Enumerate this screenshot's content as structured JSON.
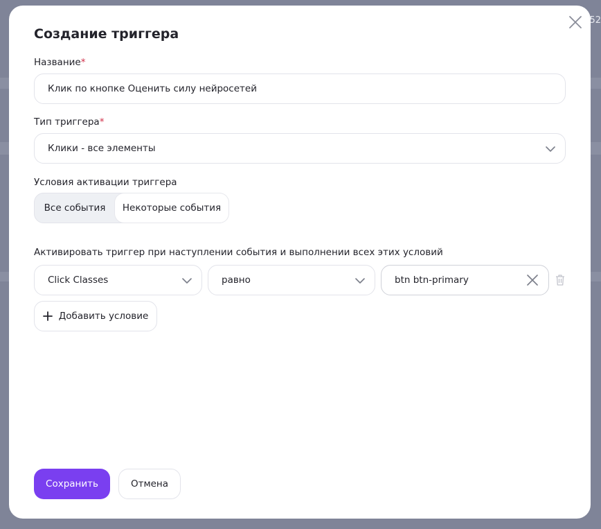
{
  "background": {
    "corner_text": "52"
  },
  "dialog": {
    "title": "Создание триггера",
    "name_field": {
      "label": "Название",
      "required_mark": "*",
      "value": "Клик по кнопке Оценить силу нейросетей"
    },
    "type_field": {
      "label": "Тип триггера",
      "required_mark": "*",
      "value": "Клики - все элементы"
    },
    "activation": {
      "label": "Условия активации триггера",
      "options": [
        "Все события",
        "Некоторые события"
      ],
      "selected": "Все события"
    },
    "conditions": {
      "label": "Активировать триггер при наступлении события и выполнении всех этих условий",
      "rows": [
        {
          "variable": "Click Classes",
          "operator": "равно",
          "value": "btn btn-primary"
        }
      ],
      "add_label": "Добавить условие"
    },
    "footer": {
      "save_label": "Сохранить",
      "cancel_label": "Отмена"
    }
  },
  "colors": {
    "accent": "#7a3ff0",
    "required": "#d1304a",
    "backdrop": "#7f8498"
  },
  "icons": [
    "close-icon",
    "chevron-down-icon",
    "clear-icon",
    "trash-icon",
    "plus-icon"
  ]
}
